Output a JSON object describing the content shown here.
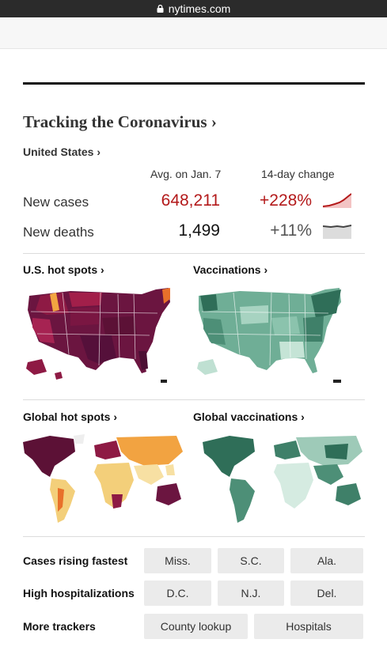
{
  "browser": {
    "url": "nytimes.com"
  },
  "widget": {
    "title": "Tracking the Coronavirus ›",
    "region": "United States ›",
    "columns": {
      "avg": "Avg. on Jan. 7",
      "change": "14-day change"
    },
    "rows": [
      {
        "label": "New cases",
        "value": "648,211",
        "change": "+228%"
      },
      {
        "label": "New deaths",
        "value": "1,499",
        "change": "+11%"
      }
    ]
  },
  "maps": {
    "us_hot_spots": "U.S. hot spots ›",
    "vaccinations": "Vaccinations ›",
    "global_hot_spots": "Global hot spots ›",
    "global_vaccinations": "Global vaccinations ›"
  },
  "quick_links": [
    {
      "title": "Cases rising fastest",
      "chips": [
        "Miss.",
        "S.C.",
        "Ala."
      ]
    },
    {
      "title": "High hospitalizations",
      "chips": [
        "D.C.",
        "N.J.",
        "Del."
      ]
    },
    {
      "title": "More trackers",
      "chips": [
        "County lookup",
        "Hospitals"
      ]
    }
  ],
  "colors": {
    "cases_red": "#b3191a",
    "hotspot_dark": "#5c1136",
    "hotspot_mid": "#8e1a44",
    "hotspot_orange": "#e8702a",
    "vacc_dark": "#2f6e58",
    "vacc_mid": "#5fa48c",
    "vacc_light": "#a7d3c1",
    "world_yellow": "#f3cf7a",
    "world_orange": "#f2a341"
  },
  "icons": [
    "lock-icon",
    "chevron-right-icon"
  ]
}
